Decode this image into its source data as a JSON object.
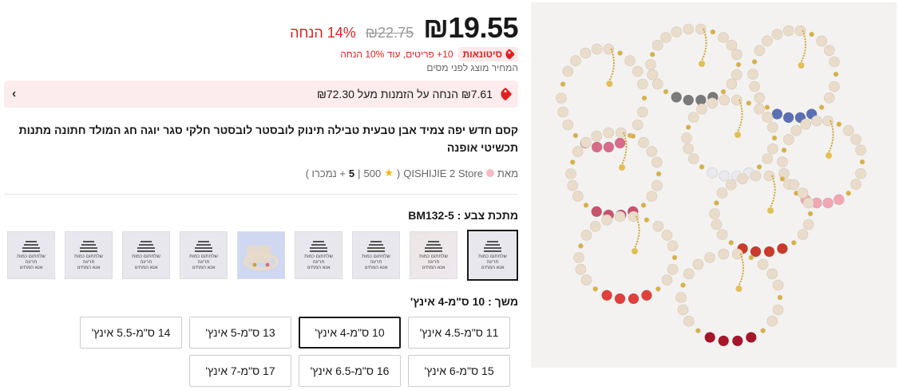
{
  "price": {
    "current": "₪19.55",
    "original": "₪22.75",
    "discount": "14% הנחה"
  },
  "promo": {
    "wholesale_label": "סיטונאות",
    "wholesale_text": "10+ פריטים, עוד 10% הנחה",
    "tax_note": "המחיר מוצג לפני מסים"
  },
  "coupon": {
    "text": "₪7.61 הנחה על הזמנות מעל ₪72.30",
    "chevron": "›"
  },
  "product": {
    "title": "קסם חדש יפה צמיד אבן טבעית טבילה תינוק לובסטר לובסטר חלקי סגר יוגה חג המולד חתונה מתנות תכשיטי אופנה"
  },
  "store": {
    "prefix": "מאת",
    "name": "QISHIJIE 2 Store",
    "rating": "500",
    "sold_count": "5",
    "sold_suffix": "+ נמכרו )"
  },
  "color": {
    "label": "מתכת צבע : BM132-5",
    "placeholder_text": [
      "שלחתום כמות",
      "חריגה",
      "אנא המתינו"
    ],
    "swatches": [
      {
        "id": "sw1",
        "selected": true
      },
      {
        "id": "sw2",
        "selected": false
      },
      {
        "id": "sw3",
        "selected": false
      },
      {
        "id": "sw4",
        "selected": false
      },
      {
        "id": "sw5",
        "selected": false
      },
      {
        "id": "sw6",
        "selected": false
      },
      {
        "id": "sw7",
        "selected": false
      },
      {
        "id": "sw8",
        "selected": false
      },
      {
        "id": "sw9",
        "selected": false
      }
    ]
  },
  "size": {
    "label": "משך : 10 ס\"מ-4 אינץ'",
    "options": [
      {
        "label": "11 ס\"מ-4.5 אינץ'",
        "selected": false
      },
      {
        "label": "10 ס\"מ-4 אינץ'",
        "selected": true
      },
      {
        "label": "13 ס\"מ-5 אינץ'",
        "selected": false
      },
      {
        "label": "14 ס\"מ-5.5 אינץ'",
        "selected": false
      },
      {
        "label": "15 ס\"מ-6 אינץ'",
        "selected": false
      },
      {
        "label": "16 ס\"מ-6.5 אינץ'",
        "selected": false
      },
      {
        "label": "17 ס\"מ-7 אינץ'",
        "selected": false
      }
    ]
  },
  "colors": {
    "accent_red": "#e02020",
    "coupon_bg": "#fdeced",
    "star": "#f7b500"
  }
}
